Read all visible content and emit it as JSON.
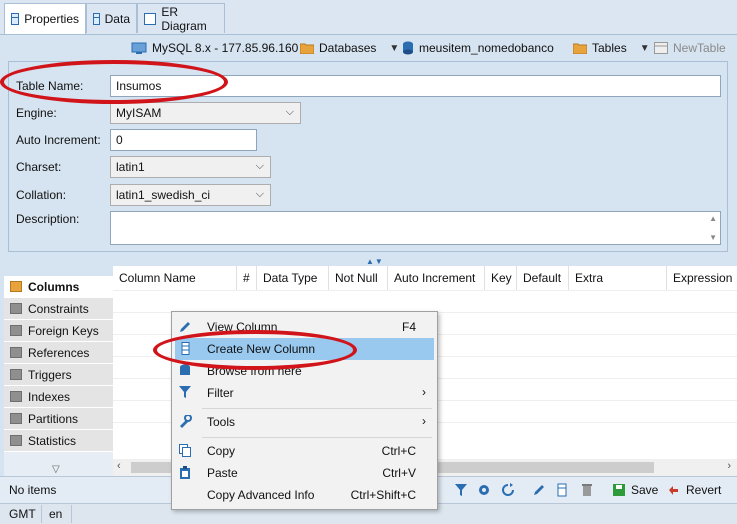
{
  "tabs": [
    {
      "label": "Properties",
      "icon": "properties-icon"
    },
    {
      "label": "Data",
      "icon": "data-grid-icon"
    },
    {
      "label": "ER Diagram",
      "icon": "er-diagram-icon"
    }
  ],
  "toolbar": {
    "connection": "MySQL 8.x - 177.85.96.160",
    "databases": "Databases",
    "database": "meusitem_nomedobanco",
    "tables": "Tables",
    "new_table": "NewTable"
  },
  "form": {
    "table_name_label": "Table Name:",
    "table_name_value": "Insumos",
    "engine_label": "Engine:",
    "engine_value": "MyISAM",
    "auto_increment_label": "Auto Increment:",
    "auto_increment_value": "0",
    "charset_label": "Charset:",
    "charset_value": "latin1",
    "collation_label": "Collation:",
    "collation_value": "latin1_swedish_ci",
    "description_label": "Description:"
  },
  "nav": [
    {
      "label": "Columns"
    },
    {
      "label": "Constraints"
    },
    {
      "label": "Foreign Keys"
    },
    {
      "label": "References"
    },
    {
      "label": "Triggers"
    },
    {
      "label": "Indexes"
    },
    {
      "label": "Partitions"
    },
    {
      "label": "Statistics"
    }
  ],
  "grid": {
    "headers": [
      "Column Name",
      "#",
      "Data Type",
      "Not Null",
      "Auto Increment",
      "Key",
      "Default",
      "Extra",
      "Expression"
    ]
  },
  "context_menu": {
    "items": [
      {
        "label": "View Column",
        "shortcut": "F4"
      },
      {
        "label": "Create New Column",
        "shortcut": ""
      },
      {
        "label": "Browse from here",
        "shortcut": ""
      },
      {
        "label": "Filter",
        "shortcut": ""
      },
      {
        "label": "Tools",
        "shortcut": ""
      },
      {
        "label": "Copy",
        "shortcut": "Ctrl+C"
      },
      {
        "label": "Paste",
        "shortcut": "Ctrl+V"
      },
      {
        "label": "Copy Advanced Info",
        "shortcut": "Ctrl+Shift+C"
      }
    ]
  },
  "status": {
    "items_text": "No items",
    "save": "Save",
    "revert": "Revert",
    "timezone": "GMT",
    "locale": "en"
  },
  "colors": {
    "highlight": "#99c9ef",
    "annotation_red": "#d0141a",
    "accent_blue": "#2a6db0"
  }
}
